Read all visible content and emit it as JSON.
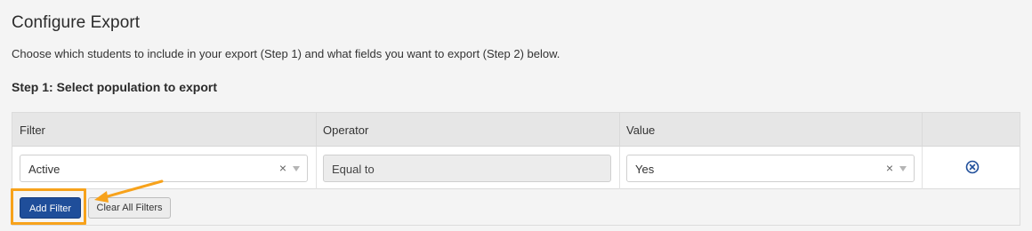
{
  "page": {
    "title": "Configure Export",
    "description": "Choose which students to include in your export (Step 1) and what fields you want to export (Step 2) below.",
    "step1_title": "Step 1: Select population to export"
  },
  "filter_table": {
    "headers": {
      "filter": "Filter",
      "operator": "Operator",
      "value": "Value"
    },
    "rows": [
      {
        "filter": "Active",
        "operator": "Equal to",
        "value": "Yes"
      }
    ],
    "clear_glyph": "×"
  },
  "buttons": {
    "add_filter": "Add Filter",
    "clear_all_filters": "Clear All Filters"
  },
  "colors": {
    "primary": "#1f4e9a",
    "highlight": "#f7a21b"
  },
  "icons": {
    "remove_row": "remove-circle-icon",
    "dropdown": "chevron-down-icon",
    "clear": "clear-x-icon"
  }
}
